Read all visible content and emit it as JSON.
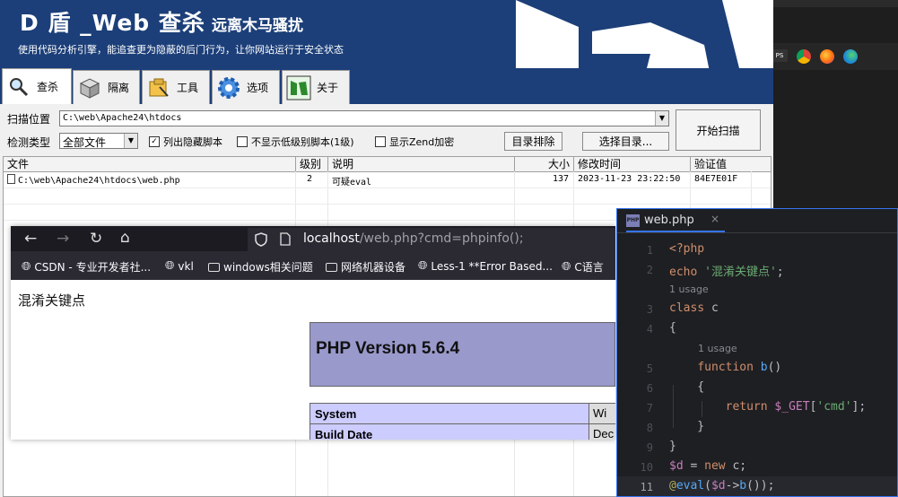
{
  "app": {
    "title": "D 盾 _Web 查杀",
    "subtitle": "远离木马骚扰",
    "description": "使用代码分析引擎，能追查更为隐蔽的后门行为，让你网站运行于安全状态"
  },
  "tabs": [
    {
      "label": "查杀",
      "icon": "magnifier-icon",
      "active": true
    },
    {
      "label": "隔离",
      "icon": "box-icon",
      "active": false
    },
    {
      "label": "工具",
      "icon": "folder-tools-icon",
      "active": false
    },
    {
      "label": "选项",
      "icon": "gear-icon",
      "active": false
    },
    {
      "label": "关于",
      "icon": "d-logo-icon",
      "active": false
    }
  ],
  "scan": {
    "path_label": "扫描位置",
    "path_value": "C:\\web\\Apache24\\htdocs",
    "type_label": "检测类型",
    "type_value": "全部文件",
    "opt_hidden": "列出隐藏脚本",
    "opt_lowlevel": "不显示低级别脚本(1级)",
    "opt_zend": "显示Zend加密",
    "btn_exclude": "目录排除",
    "btn_select": "选择目录...",
    "btn_start": "开始扫描"
  },
  "grid": {
    "headers": [
      "文件",
      "级别",
      "说明",
      "大小",
      "修改时间",
      "验证值"
    ],
    "rows": [
      {
        "file": "C:\\web\\Apache24\\htdocs\\web.php",
        "level": "2",
        "desc": "可疑eval",
        "size": "137",
        "mtime": "2023-11-23 23:22:50",
        "hash": "84E7E01F"
      }
    ]
  },
  "browser": {
    "url_host": "localhost",
    "url_path": "/web.php?cmd=phpinfo();",
    "bookmarks": [
      {
        "label": "CSDN - 专业开发者社...",
        "icon": "globe-icon"
      },
      {
        "label": "vkl",
        "icon": "globe-icon"
      },
      {
        "label": "windows相关问题",
        "icon": "folder-icon"
      },
      {
        "label": "网络机器设备",
        "icon": "folder-icon"
      },
      {
        "label": "Less-1 **Error Based...",
        "icon": "globe-icon"
      },
      {
        "label": "C语言",
        "icon": "globe-icon"
      }
    ],
    "page_text": "混淆关键点",
    "php_version": "PHP Version 5.6.4",
    "rows": [
      {
        "k": "System",
        "v": "Wi"
      },
      {
        "k": "Build Date",
        "v": "Dec"
      }
    ]
  },
  "editor": {
    "filename": "web.php",
    "close": "×",
    "usage_label": "1 usage",
    "line_numbers": [
      "1",
      "2",
      "3",
      "4",
      "5",
      "6",
      "7",
      "8",
      "9",
      "10",
      "11"
    ]
  },
  "colors": {
    "banner": "#1c3f79",
    "editor_bg": "#1e1f22",
    "editor_accent": "#3574f0"
  }
}
